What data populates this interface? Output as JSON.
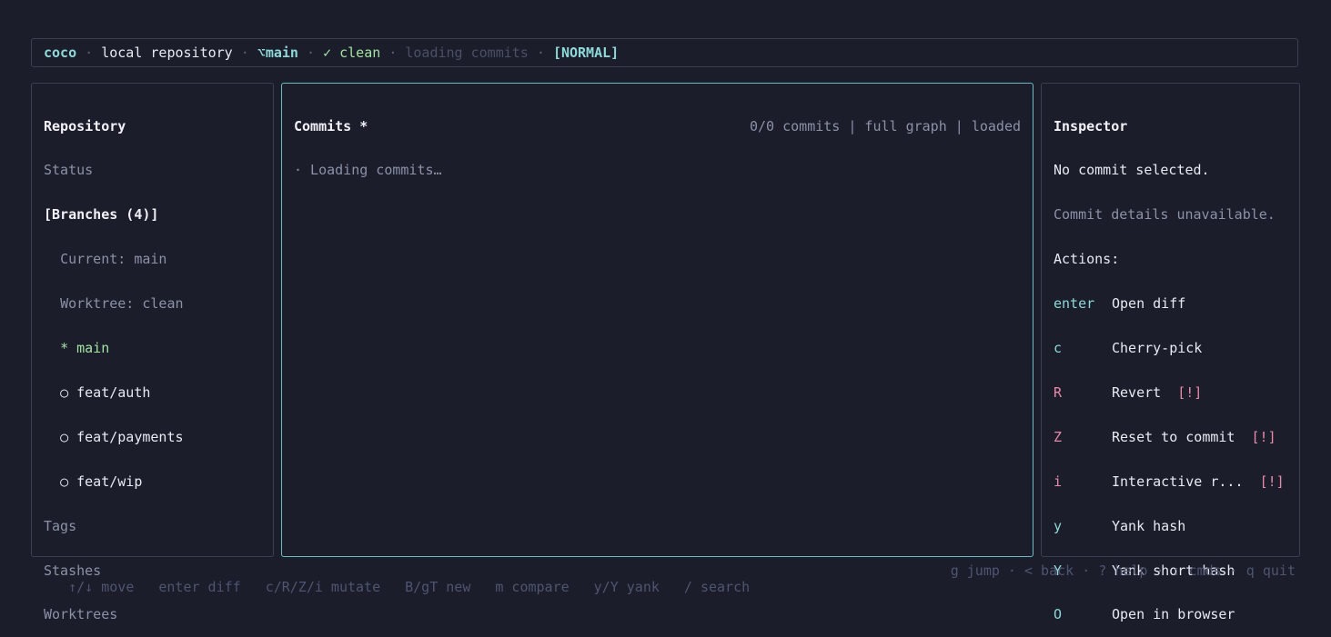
{
  "statusbar": {
    "app": "coco",
    "repo": "local repository",
    "branch_icon": "⌥",
    "branch": "main",
    "clean": "✓ clean",
    "loading": "loading commits",
    "mode": "[NORMAL]",
    "sep": "·"
  },
  "left": {
    "title": "Repository",
    "status": "Status",
    "branches_header": "[Branches (4)]",
    "current": "Current: main",
    "worktree": "Worktree: clean",
    "branches": [
      {
        "marker": "*",
        "name": "main"
      },
      {
        "marker": "○",
        "name": "feat/auth"
      },
      {
        "marker": "○",
        "name": "feat/payments"
      },
      {
        "marker": "○",
        "name": "feat/wip"
      }
    ],
    "tags": "Tags",
    "stashes": "Stashes",
    "worktrees": "Worktrees"
  },
  "middle": {
    "title": "Commits *",
    "meta": "0/0 commits | full graph | loaded",
    "loading": "· Loading commits…"
  },
  "right": {
    "title": "Inspector",
    "no_commit": "No commit selected.",
    "unavailable": "Commit details unavailable.",
    "actions_label": "Actions:",
    "actions": [
      {
        "key": "enter",
        "label": "Open diff",
        "warn": ""
      },
      {
        "key": "c",
        "label": "Cherry-pick",
        "warn": ""
      },
      {
        "key": "R",
        "label": "Revert",
        "warn": "[!]"
      },
      {
        "key": "Z",
        "label": "Reset to commit",
        "warn": "[!]"
      },
      {
        "key": "i",
        "label": "Interactive r...",
        "warn": "[!]"
      },
      {
        "key": "y",
        "label": "Yank hash",
        "warn": ""
      },
      {
        "key": "Y",
        "label": "Yank short hash",
        "warn": ""
      },
      {
        "key": "O",
        "label": "Open in browser",
        "warn": ""
      }
    ]
  },
  "footer": {
    "left": [
      "↑/↓ move",
      "enter diff",
      "c/R/Z/i mutate",
      "B/gT new",
      "m compare",
      "y/Y yank",
      "/ search"
    ],
    "right": "g jump · < back · ? help · : cmds · q quit"
  },
  "colors": {
    "background": "#1b1d2b",
    "border": "#3b3f55",
    "active_border": "#6fb7c2",
    "accent": "#8fd8d9",
    "green": "#a3e3a1",
    "danger": "#e98aa6"
  }
}
